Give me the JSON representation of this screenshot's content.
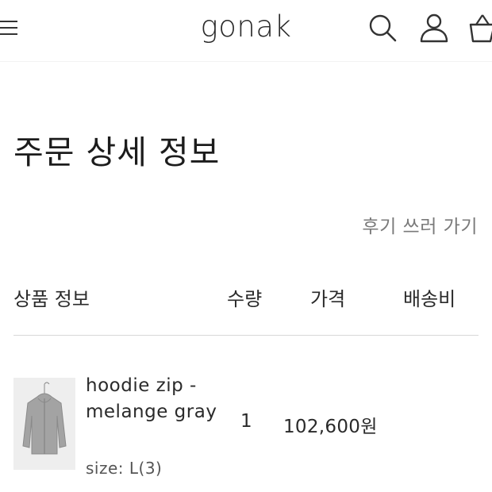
{
  "header": {
    "logo": "gonak",
    "icons": [
      "menu-icon",
      "search-icon",
      "user-icon",
      "cart-icon"
    ]
  },
  "page": {
    "title": "주문 상세 정보",
    "review_link": "후기 쓰러 가기"
  },
  "table": {
    "headers": {
      "product": "상품 정보",
      "quantity": "수량",
      "price": "가격",
      "shipping": "배송비"
    },
    "items": [
      {
        "name": "hoodie zip - melange gray",
        "option": "size: L(3)",
        "quantity": "1",
        "price": "102,600원",
        "shipping": ""
      }
    ]
  },
  "colors": {
    "text": "#222222",
    "muted": "#7a7a7a",
    "divider": "#d8d8d8"
  }
}
